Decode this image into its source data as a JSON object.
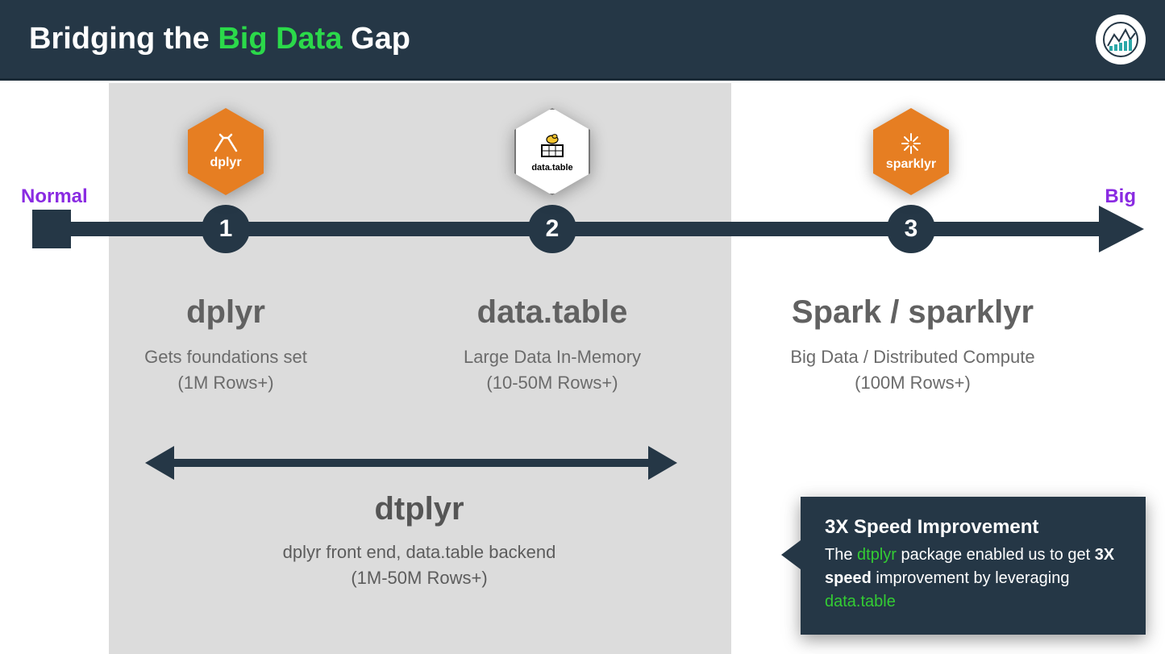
{
  "header": {
    "title_pre": "Bridging the ",
    "title_accent": "Big Data",
    "title_post": " Gap"
  },
  "timeline": {
    "start_label": "Normal",
    "end_label": "Big",
    "nodes": [
      "1",
      "2",
      "3"
    ]
  },
  "hex": {
    "dplyr_label": "dplyr",
    "datatable_label": "data.table",
    "sparklyr_label": "sparklyr"
  },
  "columns": [
    {
      "title": "dplyr",
      "desc": "Gets foundations set",
      "rows": "(1M Rows+)"
    },
    {
      "title": "data.table",
      "desc": "Large Data In-Memory",
      "rows": "(10-50M Rows+)"
    },
    {
      "title": "Spark / sparklyr",
      "desc": "Big Data / Distributed Compute",
      "rows": "(100M Rows+)"
    }
  ],
  "dtplyr": {
    "title": "dtplyr",
    "desc": "dplyr front end, data.table backend",
    "rows": "(1M-50M Rows+)"
  },
  "callout": {
    "heading": "3X Speed Improvement",
    "line1a": "The ",
    "line1g": "dtplyr",
    "line1b": " package enabled us to get ",
    "line1bold": "3X speed",
    "line1c": " improvement by leveraging ",
    "line1g2": "data.table"
  }
}
